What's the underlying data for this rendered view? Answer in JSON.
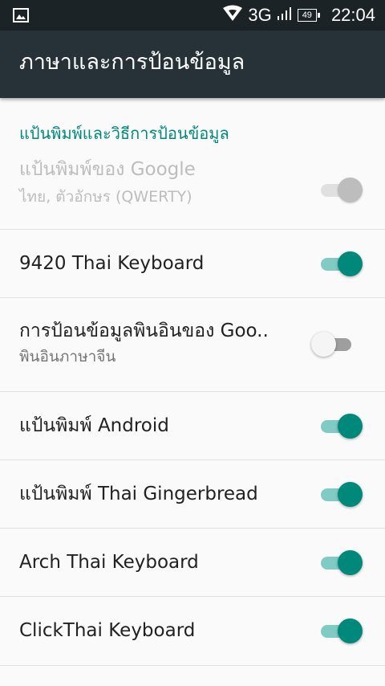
{
  "status_bar": {
    "network": "3G",
    "battery": "49",
    "time": "22:04"
  },
  "app_bar": {
    "title": "ภาษาและการป้อนข้อมูล"
  },
  "section": {
    "title": "แป้นพิมพ์และวิธีการป้อนข้อมูล"
  },
  "keyboards": [
    {
      "label": "แป้นพิมพ์ของ Google",
      "summary": "ไทย, ตัวอักษร (QWERTY)",
      "enabled": true,
      "disabled": true
    },
    {
      "label": "9420 Thai Keyboard",
      "enabled": true
    },
    {
      "label": "การป้อนข้อมูลพินอินของ Goo..",
      "summary": "พินอินภาษาจีน",
      "enabled": false
    },
    {
      "label": "แป้นพิมพ์ Android",
      "enabled": true
    },
    {
      "label": "แป้นพิมพ์ Thai Gingerbread",
      "enabled": true
    },
    {
      "label": "Arch Thai Keyboard",
      "enabled": true
    },
    {
      "label": "ClickThai Keyboard",
      "enabled": true
    }
  ],
  "colors": {
    "accent": "#00897b",
    "app_bar": "#263238",
    "status_bar": "#1b2326"
  },
  "icons": {
    "status_left": "image-notification-icon",
    "signal": "signal-icon",
    "battery": "battery-icon"
  }
}
